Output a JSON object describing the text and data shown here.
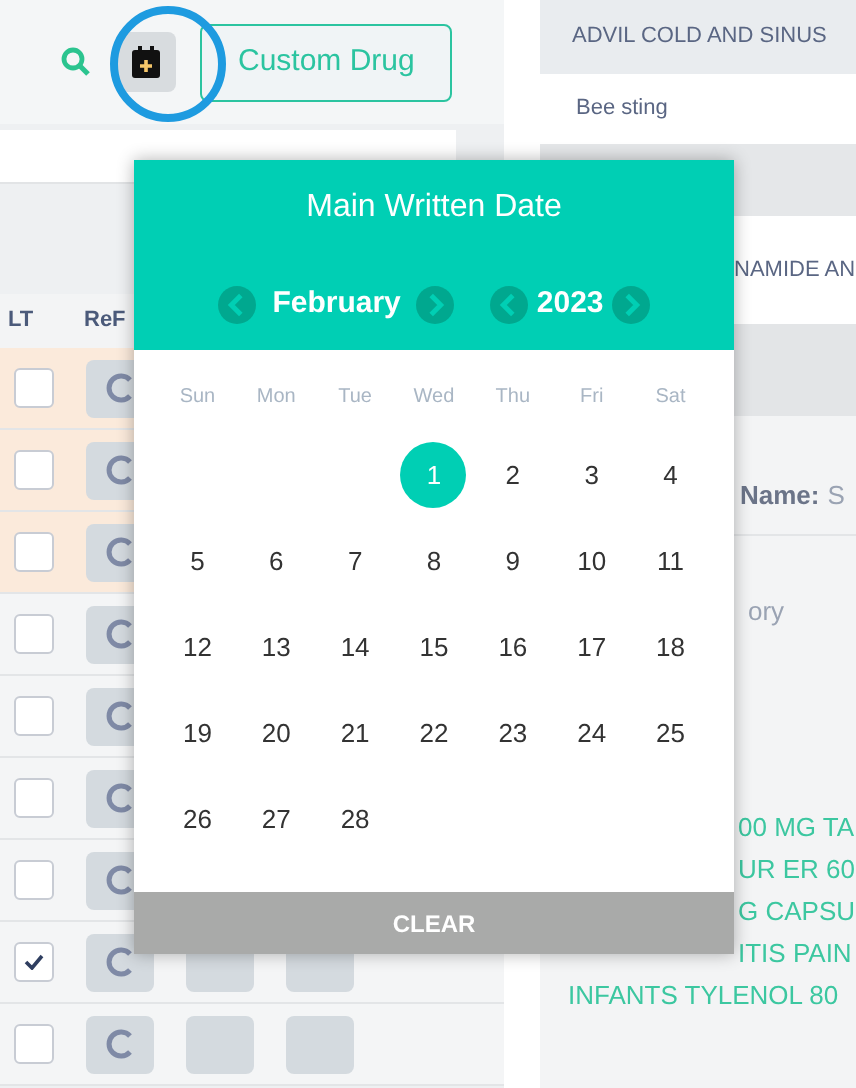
{
  "toolbar": {
    "custom_drug_button": "Custom Drug"
  },
  "table": {
    "columns": [
      "LT",
      "ReF"
    ],
    "rows": [
      {
        "highlighted": true,
        "checked": false
      },
      {
        "highlighted": true,
        "checked": false
      },
      {
        "highlighted": true,
        "checked": false
      },
      {
        "highlighted": false,
        "checked": false
      },
      {
        "highlighted": false,
        "checked": false
      },
      {
        "highlighted": false,
        "checked": false
      },
      {
        "highlighted": false,
        "checked": false
      },
      {
        "highlighted": false,
        "checked": true
      },
      {
        "highlighted": false,
        "checked": false
      }
    ]
  },
  "details": {
    "header": "ADVIL COLD AND SINUS",
    "allergy": "Bee sting",
    "partial_header": "NAMIDE AN",
    "name_label": "Name:",
    "name_value": "S",
    "partial_text": "ory",
    "drug_list": [
      {
        "text": "00 MG TA",
        "covered": true
      },
      {
        "text": "UR ER 60",
        "covered": true
      },
      {
        "text": "G CAPSU",
        "covered": true
      },
      {
        "text": "ITIS PAIN",
        "covered": true
      },
      {
        "text": "INFANTS TYLENOL 80",
        "covered": false
      }
    ]
  },
  "date_picker": {
    "title": "Main Written Date",
    "month": "February",
    "year": "2023",
    "weekdays": [
      "Sun",
      "Mon",
      "Tue",
      "Wed",
      "Thu",
      "Fri",
      "Sat"
    ],
    "days": [
      {
        "kind": "blank"
      },
      {
        "kind": "blank"
      },
      {
        "kind": "blank"
      },
      {
        "label": "1",
        "selected": true
      },
      {
        "label": "2",
        "selected": false
      },
      {
        "label": "3",
        "selected": false
      },
      {
        "label": "4",
        "selected": false
      },
      {
        "label": "5",
        "selected": false
      },
      {
        "label": "6",
        "selected": false
      },
      {
        "label": "7",
        "selected": false
      },
      {
        "label": "8",
        "selected": false
      },
      {
        "label": "9",
        "selected": false
      },
      {
        "label": "10",
        "selected": false
      },
      {
        "label": "11",
        "selected": false
      },
      {
        "label": "12",
        "selected": false
      },
      {
        "label": "13",
        "selected": false
      },
      {
        "label": "14",
        "selected": false
      },
      {
        "label": "15",
        "selected": false
      },
      {
        "label": "16",
        "selected": false
      },
      {
        "label": "17",
        "selected": false
      },
      {
        "label": "18",
        "selected": false
      },
      {
        "label": "19",
        "selected": false
      },
      {
        "label": "20",
        "selected": false
      },
      {
        "label": "21",
        "selected": false
      },
      {
        "label": "22",
        "selected": false
      },
      {
        "label": "23",
        "selected": false
      },
      {
        "label": "24",
        "selected": false
      },
      {
        "label": "25",
        "selected": false
      },
      {
        "label": "26",
        "selected": false
      },
      {
        "label": "27",
        "selected": false
      },
      {
        "label": "28",
        "selected": false
      }
    ],
    "clear_button": "CLEAR"
  }
}
